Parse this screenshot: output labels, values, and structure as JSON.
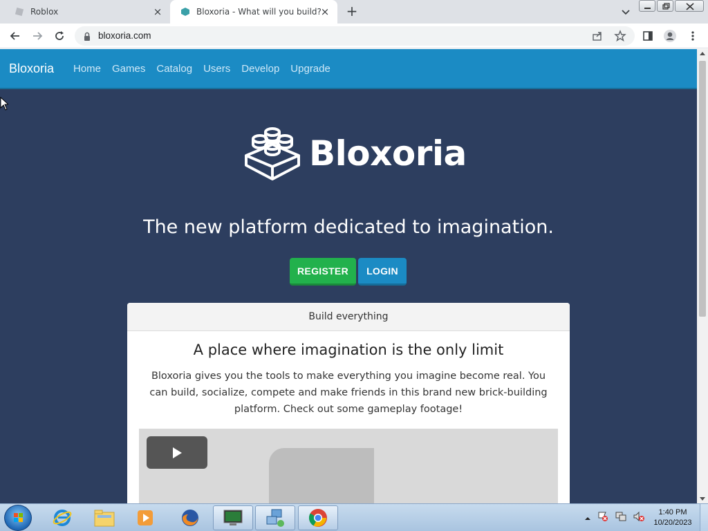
{
  "browser": {
    "tabs": [
      {
        "title": "Roblox",
        "active": false
      },
      {
        "title": "Bloxoria - What will you build?",
        "active": true
      }
    ],
    "url": "bloxoria.com"
  },
  "site": {
    "brand": "Bloxoria",
    "nav": [
      "Home",
      "Games",
      "Catalog",
      "Users",
      "Develop",
      "Upgrade"
    ],
    "logo_text": "Bloxoria",
    "tagline": "The new platform dedicated to imagination.",
    "register_label": "REGISTER",
    "login_label": "LOGIN",
    "card": {
      "header": "Build everything",
      "title": "A place where imagination is the only limit",
      "body": "Bloxoria gives you the tools to make everything you imagine become real. You can build, socialize, compete and make friends in this brand new brick-building platform. Check out some gameplay footage!"
    },
    "colors": {
      "background": "#2d3e5f",
      "navbar": "#1b8bc4",
      "register": "#22b14c",
      "login": "#1b8bc4"
    }
  },
  "taskbar": {
    "apps": [
      "internet-explorer-icon",
      "file-explorer-icon",
      "media-player-icon",
      "firefox-icon",
      "terminal-icon",
      "network-icon",
      "chrome-icon"
    ],
    "time": "1:40 PM",
    "date": "10/20/2023"
  }
}
